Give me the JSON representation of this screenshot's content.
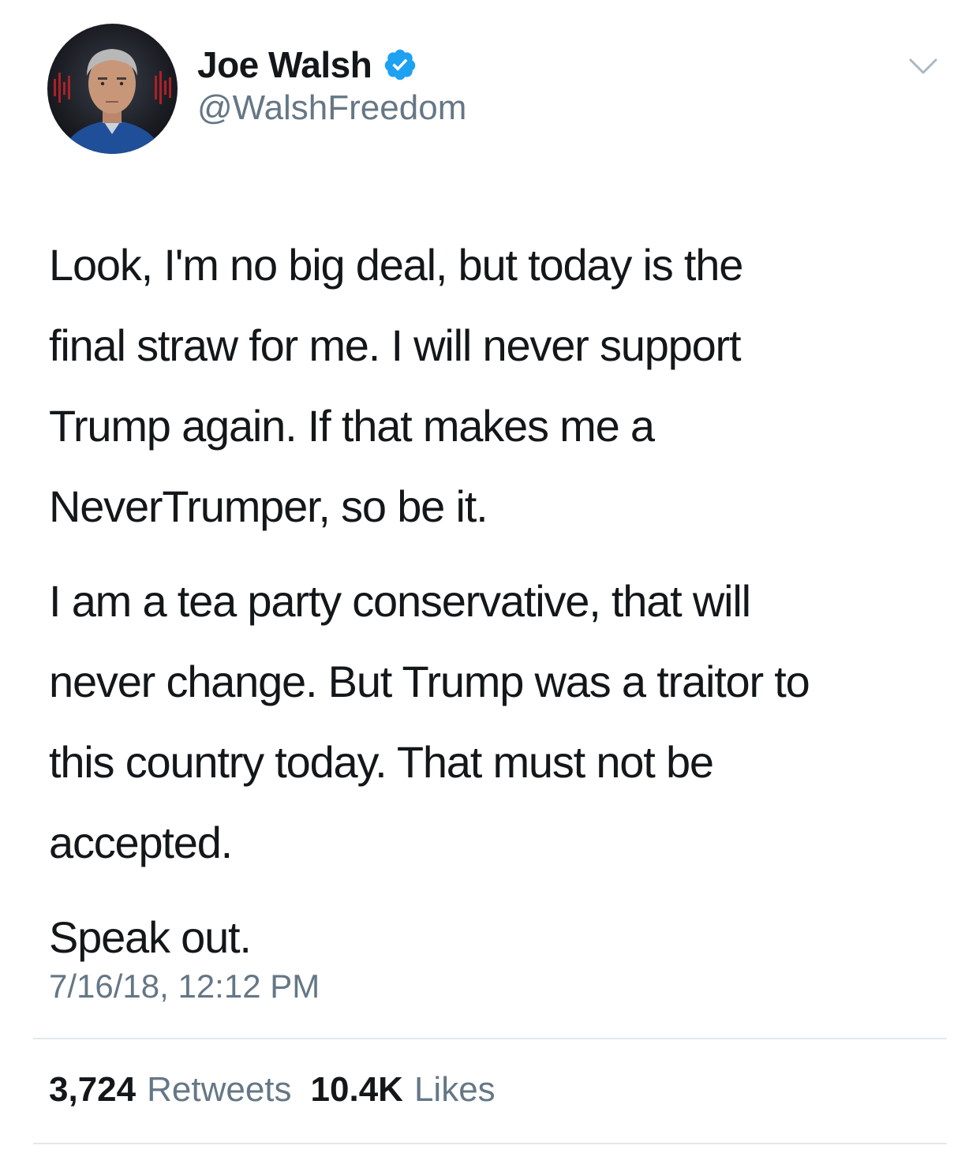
{
  "author": {
    "display_name": "Joe Walsh",
    "handle": "@WalshFreedom",
    "verified": true
  },
  "tweet": {
    "paragraphs": [
      "Look, I'm no big deal, but today is the\nfinal straw for me. I will never support\nTrump again. If that makes me a\nNeverTrumper, so be it.",
      "I am a tea party conservative, that will\nnever change. But Trump was a traitor to\nthis country today. That must not be\naccepted.",
      "Speak out."
    ],
    "timestamp": "7/16/18, 12:12 PM"
  },
  "stats": {
    "retweets_count": "3,724",
    "retweets_label": "Retweets",
    "likes_count": "10.4K",
    "likes_label": "Likes"
  },
  "icons": {
    "verified": "verified-badge-icon",
    "menu": "chevron-down-icon"
  },
  "colors": {
    "text": "#14171a",
    "secondary": "#657786",
    "verified": "#1da1f2",
    "divider": "#e1e8ed"
  }
}
